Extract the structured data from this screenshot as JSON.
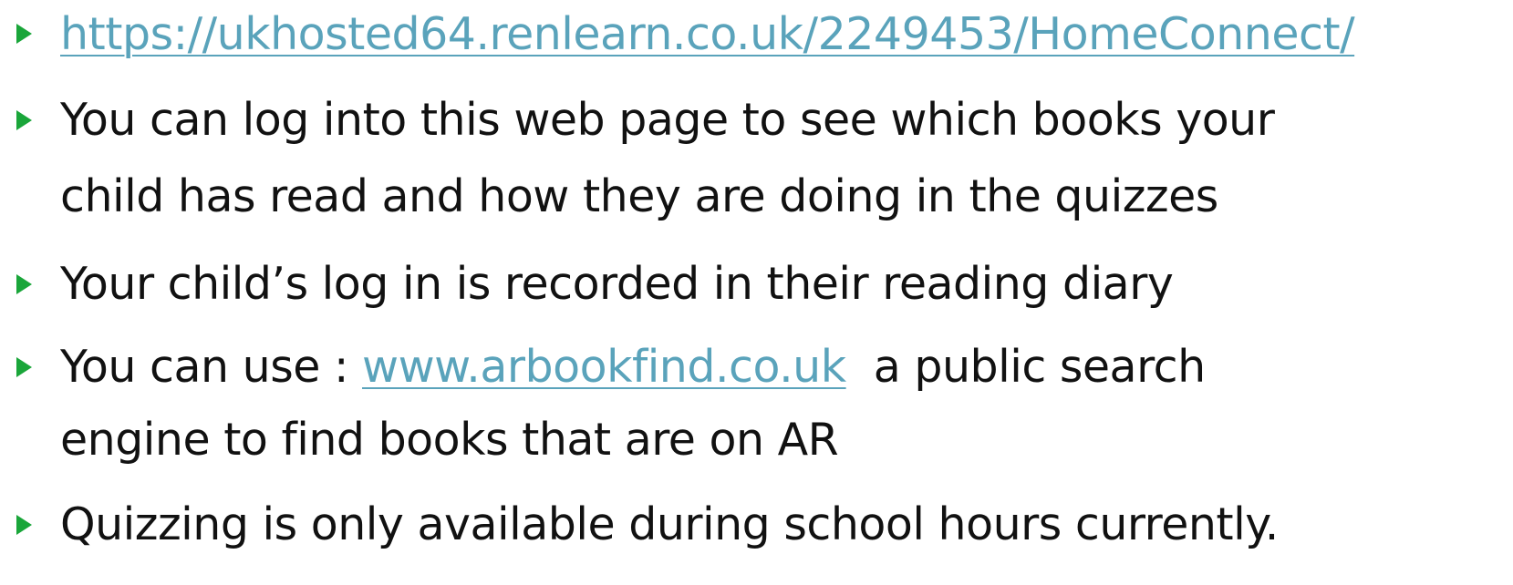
{
  "bullets": [
    {
      "link": "https://ukhosted64.renlearn.co.uk/2249453/HomeConnect/"
    },
    {
      "line1": "You can log into this web page to see which books your",
      "line2": "child has read and how they are doing in the quizzes"
    },
    {
      "text": "Your child’s log in is recorded in their reading diary"
    },
    {
      "prefix": "You can use : ",
      "link": "www.arbookfind.co.uk",
      "suffix": "  a public search",
      "line2": "engine to find books that are on AR"
    },
    {
      "text": "Quizzing is only available during school hours currently."
    }
  ],
  "colors": {
    "bullet_arrow": "#1aa63a",
    "link": "#5aa3bb",
    "text": "#111111"
  },
  "icons": {
    "bullet": "triangle-right-icon"
  }
}
